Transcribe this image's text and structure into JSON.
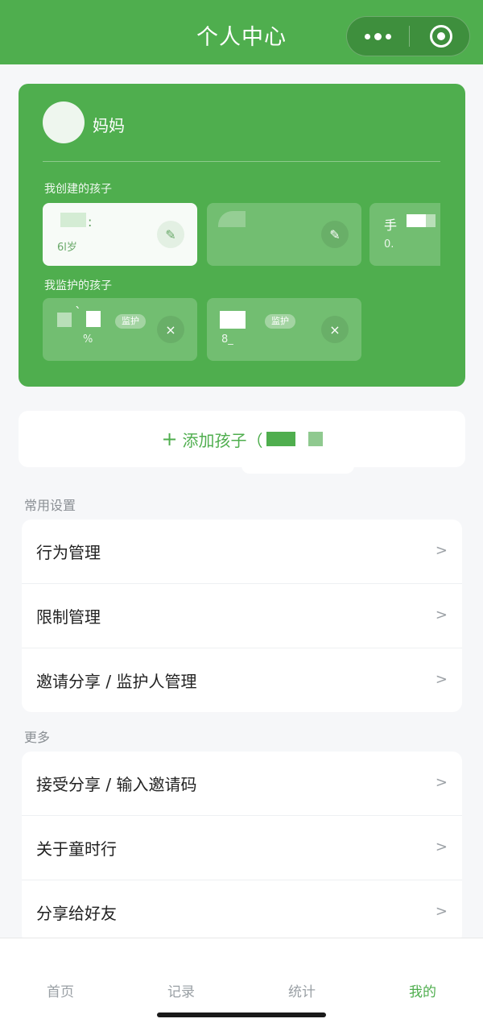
{
  "header": {
    "title": "个人中心"
  },
  "profile": {
    "username": "妈妈",
    "created_label": "我创建的孩子",
    "guarded_label": "我监护的孩子",
    "created_children": [
      {
        "name": ":",
        "sub": "ا6岁",
        "active": true,
        "action_icon": "edit-icon",
        "action_symbol": "✎"
      },
      {
        "name": "",
        "sub": "",
        "active": false,
        "action_icon": "edit-icon",
        "action_symbol": "✎"
      },
      {
        "name": "手",
        "sub": "0.",
        "active": false,
        "action_icon": "",
        "action_symbol": ""
      }
    ],
    "guarded_children": [
      {
        "name": "`",
        "sub": "%",
        "tag": "监护",
        "action_icon": "remove-icon",
        "action_symbol": "×"
      },
      {
        "name": "",
        "sub": "8_",
        "tag": "监护",
        "action_icon": "remove-icon",
        "action_symbol": "×"
      }
    ]
  },
  "add_child": {
    "plus": "+",
    "label": "添加孩子（"
  },
  "groups": [
    {
      "title": "常用设置",
      "items": [
        "行为管理",
        "限制管理",
        "邀请分享 / 监护人管理"
      ]
    },
    {
      "title": "更多",
      "items": [
        "接受分享 / 输入邀请码",
        "关于童时行",
        "分享给好友"
      ]
    }
  ],
  "chevron": ">",
  "tabbar": {
    "tabs": [
      "首页",
      "记录",
      "统计",
      "我的"
    ],
    "active_index": 3
  },
  "colors": {
    "brand": "#4fae4e",
    "background": "#f6f7f9"
  }
}
